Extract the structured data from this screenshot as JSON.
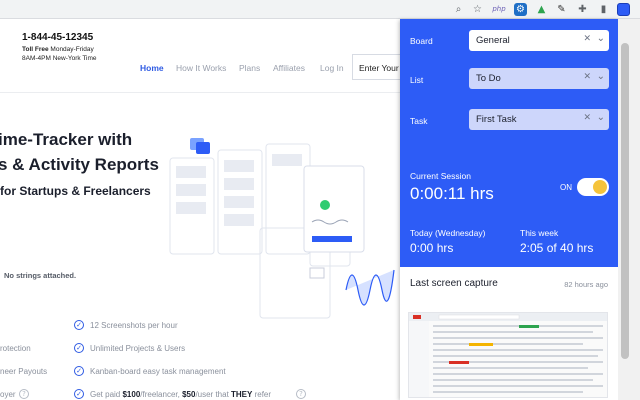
{
  "browser": {
    "icons": [
      "zoom-icon",
      "star-icon",
      "php-extension-icon",
      "extension-icon",
      "extension-icon",
      "extension-icon",
      "puzzle-icon",
      "tracker-extension-icon"
    ],
    "php_label": "php"
  },
  "site": {
    "phone": "1-844-45-12345",
    "toll_free_label": "Toll Free",
    "toll_free_hours": " Monday-Friday",
    "hours": "8AM-4PM New-York Time",
    "nav": [
      "Home",
      "How It Works",
      "Plans",
      "Affiliates",
      "Log In"
    ],
    "enter_placeholder": "Enter Your",
    "hero_line1": "ime-Tracker with",
    "hero_line2": "s & Activity Reports",
    "hero_line3": "for Startups & Freelancers",
    "no_strings": "No strings attached.",
    "features_right": [
      "12 Screenshots per hour",
      "Unlimited Projects & Users",
      "Kanban-board easy task management"
    ],
    "paid_prefix": "Get paid ",
    "paid_amount1": "$100",
    "paid_mid": "/freelancer, ",
    "paid_amount2": "$50",
    "paid_mid2": "/user that ",
    "paid_they": "THEY",
    "paid_suffix": " refer",
    "features_left": [
      "rotection",
      "neer Payouts",
      "oyer"
    ]
  },
  "popup": {
    "board_label": "Board",
    "board_value": "General",
    "list_label": "List",
    "list_value": "To Do",
    "task_label": "Task",
    "task_value": "First Task",
    "session_label": "Current Session",
    "session_value": "0:00:11 hrs",
    "toggle_label": "ON",
    "today_label": "Today (Wednesday)",
    "today_value": "0:00 hrs",
    "week_label": "This week",
    "week_value": "2:05 of 40 hrs",
    "capture_label": "Last screen capture",
    "capture_ago": "82 hours ago",
    "accent": "#2d5cf6",
    "toggle_color": "#f5c33b"
  }
}
